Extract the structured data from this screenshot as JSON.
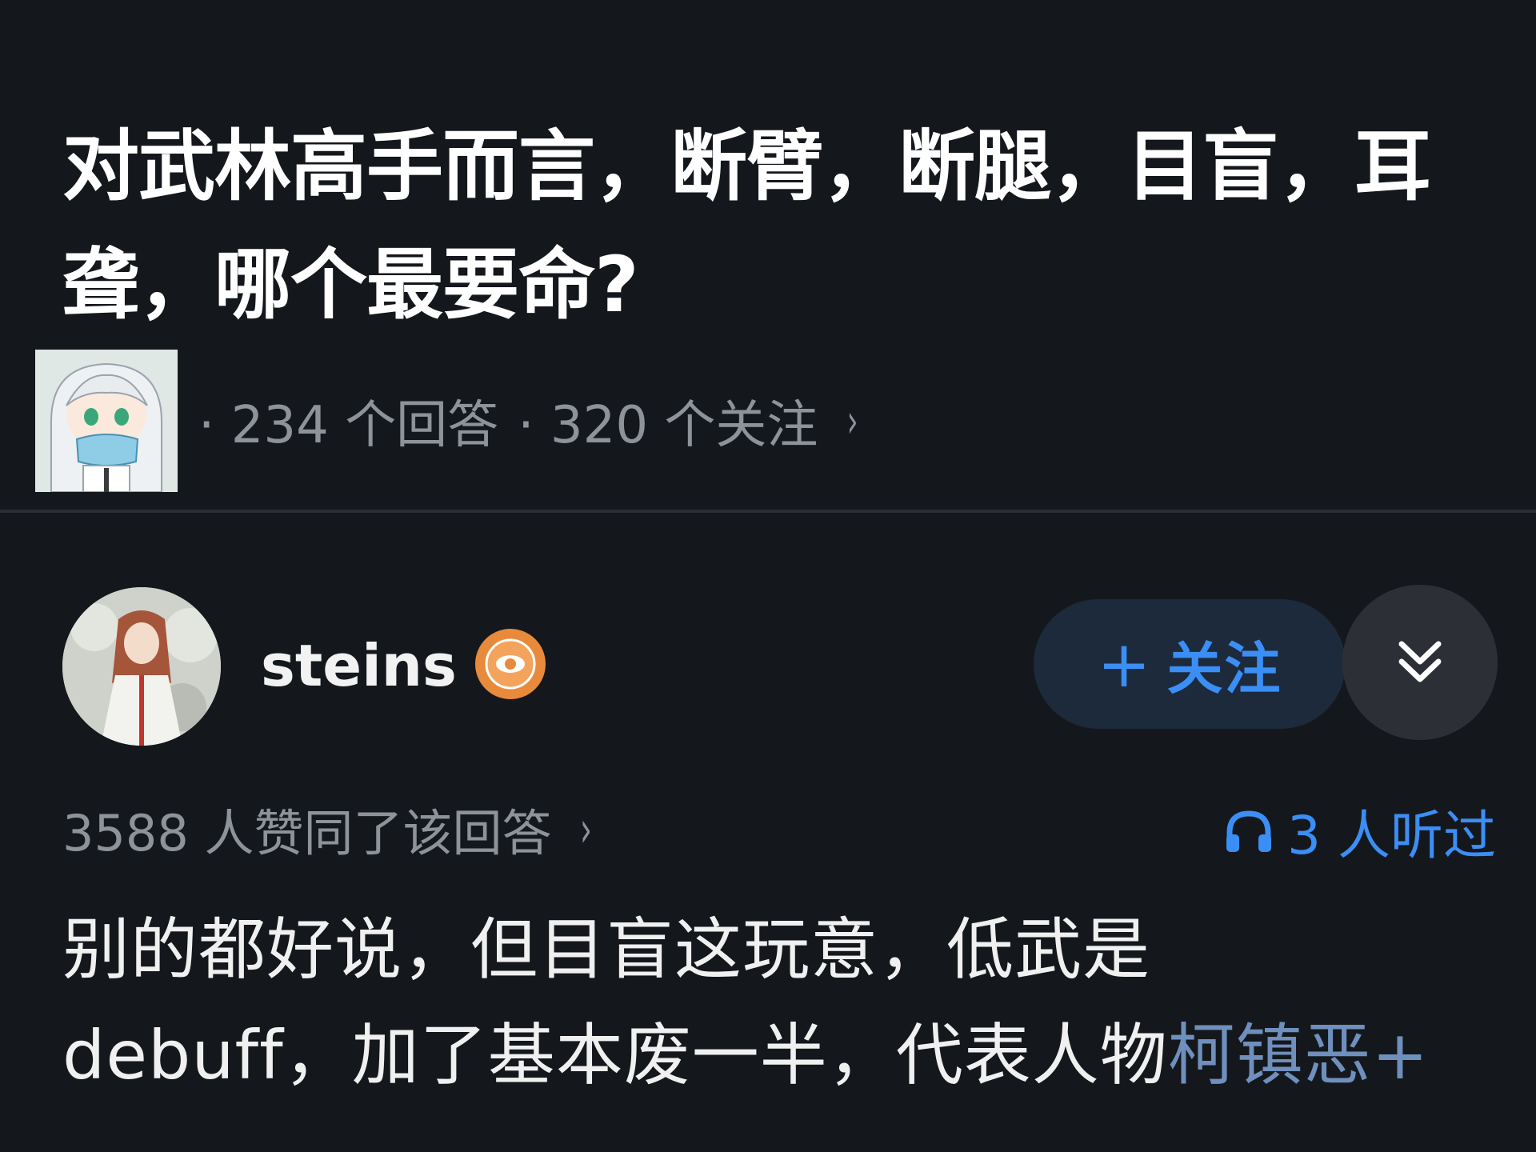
{
  "question": {
    "title": "对武林高手而言，断臂，断腿，目盲，耳聋，哪个最要命?",
    "answer_count": "· 234 个回答",
    "follow_count": "· 320 个关注",
    "chevron": "›"
  },
  "answer": {
    "author_name": "steins",
    "follow_plus": "+",
    "follow_label": "关注",
    "approve_text": "3588 人赞同了该回答",
    "approve_chevron": "›",
    "listen_text": "3 人听过",
    "body_text": "别的都好说，但目盲这玩意，低武是debuff，加了基本废一半，代表人物",
    "body_link": "柯镇恶",
    "body_tail": "+"
  },
  "colors": {
    "background": "#14181c",
    "accent_blue": "#3b8ef5",
    "muted_text": "#8d9399",
    "link_text": "#6f8fbd",
    "badge_orange": "#e88a3c"
  },
  "icons": {
    "question_avatar": "anime-girl-avatar-icon",
    "author_avatar": "anime-character-avatar-icon",
    "author_badge": "eye-badge-icon",
    "more": "double-chevron-down-icon",
    "listen": "headphones-icon"
  }
}
